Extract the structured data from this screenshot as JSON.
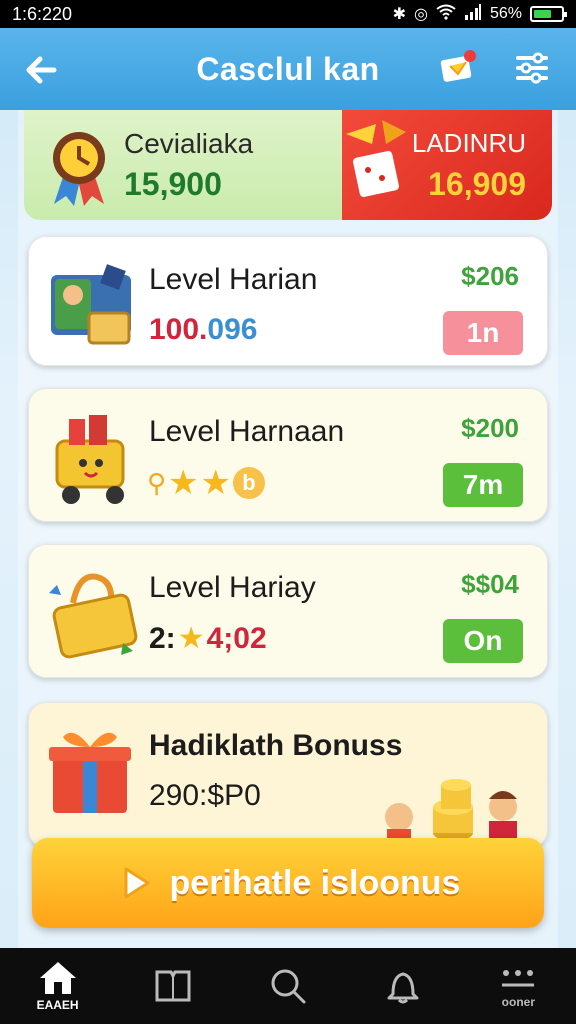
{
  "status_bar": {
    "time": "1:6:220",
    "battery": "56%"
  },
  "header": {
    "title": "Casclul kan"
  },
  "top_card": {
    "left_label": "Cevialiaka",
    "left_value": "15,900",
    "right_label": "LADINRU",
    "right_value": "16,909"
  },
  "cards": [
    {
      "title": "Level Harian",
      "reward": "$206",
      "sub": "100.096",
      "badge": "1n"
    },
    {
      "title": "Level Harnaan",
      "reward": "$200",
      "sub": "",
      "badge": "7m"
    },
    {
      "title": "Level Hariay",
      "reward": "$$04",
      "sub_a": "2:",
      "sub_b": "4;02",
      "badge": "On"
    },
    {
      "title": "Hadiklath Bonuss",
      "sub": "290:$P0"
    }
  ],
  "cta": {
    "label": "perihatle isloonus"
  },
  "bottom_nav": [
    {
      "label": "EAAEH",
      "icon": "home-icon"
    },
    {
      "label": "",
      "icon": "book-icon"
    },
    {
      "label": "",
      "icon": "search-icon"
    },
    {
      "label": "",
      "icon": "bell-icon"
    },
    {
      "label": "ooner",
      "icon": "menu-dots-icon"
    }
  ],
  "colors": {
    "header": "#3aa0df",
    "reward_green": "#3fa33b",
    "cta_orange": "#ffa318",
    "top_red": "#d9281e"
  }
}
